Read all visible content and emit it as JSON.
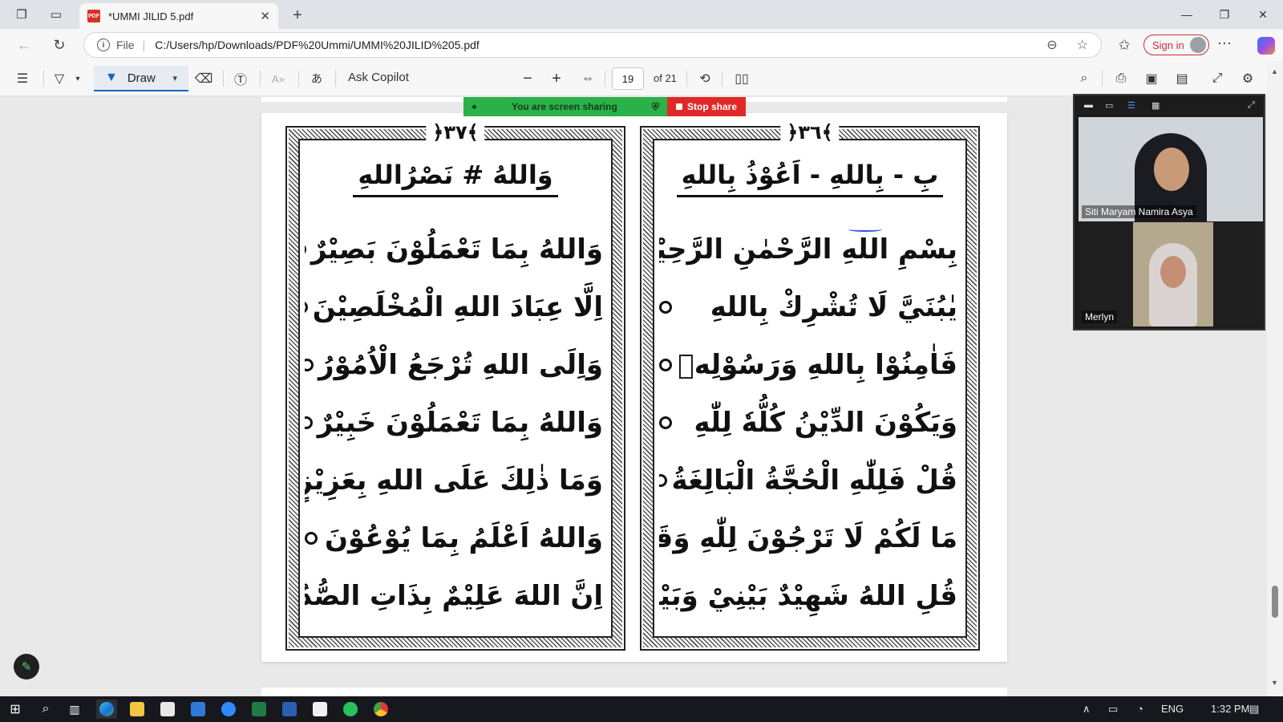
{
  "browser": {
    "tab_title": "*UMMI JILID 5.pdf",
    "tab_close": "✕",
    "new_tab": "+",
    "address": {
      "scheme_label": "File",
      "url": "C:/Users/hp/Downloads/PDF%20Ummi/UMMI%20JILID%205.pdf"
    },
    "sign_in_label": "Sign in"
  },
  "pdf_toolbar": {
    "draw_label": "Draw",
    "ask_copilot_label": "Ask Copilot",
    "current_page": "19",
    "total_pages_label": "of 21"
  },
  "screen_share": {
    "status_text": "You are screen sharing",
    "stop_label": "Stop share"
  },
  "video_panel": {
    "participants": [
      {
        "name": "Siti Maryam Namira Asya"
      },
      {
        "name": "Merlyn"
      }
    ]
  },
  "pdf_pages": {
    "left": {
      "page_number": "﴿٣٧﴾",
      "heading": "وَاللهُ # نَصْرُاللهِ",
      "lines": [
        "وَاللهُ بِمَا تَعْمَلُوْنَ بَصِيْرٌ",
        "اِلَّا عِبَادَ اللهِ الْمُخْلَصِيْنَ",
        "وَاِلَى اللهِ تُرْجَعُ الْاُمُوْرُ",
        "وَاللهُ بِمَا تَعْمَلُوْنَ خَبِيْرٌ",
        "وَمَا ذٰلِكَ عَلَى اللهِ بِعَزِيْزٍ",
        "وَاللهُ اَعْلَمُ بِمَا يُوْعُوْنَ",
        "اِنَّ اللهَ عَلِيْمٌ بِذَاتِ الصُّدُوْرِ"
      ]
    },
    "right": {
      "page_number": "﴿٣٦﴾",
      "heading": "بِ - بِاللهِ - اَعُوْذُ بِاللهِ",
      "lines": [
        "بِسْمِ اللهِ الرَّحْمٰنِ الرَّحِيْمِ",
        "يٰبُنَيَّ لَا تُشْرِكْ بِاللهِ",
        "فَاٰمِنُوْا بِاللهِ وَرَسُوْلِهٖ",
        "وَيَكُوْنَ الدِّيْنُ كُلُّهٗ لِلّٰهِ",
        "قُلْ فَلِلّٰهِ الْحُجَّةُ الْبَالِغَةُ",
        "مَا لَكُمْ لَا تَرْجُوْنَ لِلّٰهِ وَقَارًا",
        "قُلِ اللهُ شَهِيْدٌ بَيْنِيْ وَبَيْنَكُمْ"
      ]
    }
  },
  "taskbar": {
    "language": "ENG",
    "time": "1:32 PM"
  },
  "colors": {
    "share_green": "#2bb14a",
    "share_red": "#e02828",
    "accent_blue": "#1a63c6",
    "sign_in_red": "#c92d3a"
  },
  "icons": [
    "workspaces-icon",
    "tab-actions-icon",
    "pdf-file-icon",
    "back-icon",
    "reload-icon",
    "info-icon",
    "zoom-icon",
    "favorite-star-icon",
    "favorites-icon",
    "profile-avatar-icon",
    "more-icon",
    "copilot-icon",
    "contents-icon",
    "highlight-icon",
    "draw-pen-icon",
    "eraser-icon",
    "text-box-icon",
    "read-aloud-icon",
    "translate-icon",
    "zoom-out-icon",
    "zoom-in-icon",
    "fit-page-icon",
    "rotate-icon",
    "page-view-icon",
    "search-icon",
    "print-icon",
    "save-icon",
    "save-as-icon",
    "fullscreen-icon",
    "settings-icon",
    "edit-icon",
    "windows-start-icon",
    "search-taskbar-icon",
    "task-view-icon",
    "edge-icon",
    "file-explorer-icon",
    "store-icon",
    "mail-icon",
    "zoom-app-icon",
    "excel-icon",
    "word-icon",
    "whatsapp-icon",
    "chrome-icon",
    "notification-icon"
  ]
}
